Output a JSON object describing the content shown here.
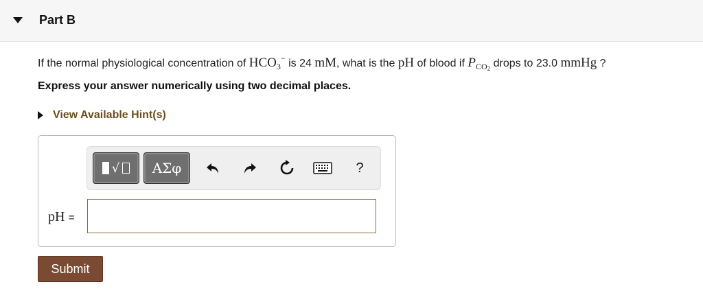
{
  "part": {
    "title": "Part B"
  },
  "question": {
    "t1": "If the normal physiological concentration of ",
    "ion": "HCO",
    "ion_sub": "3",
    "ion_sup": "−",
    "t2": " is 24 ",
    "conc_unit": "mM",
    "t3": ", what is the ",
    "ph": "pH",
    "t4": " of blood if ",
    "p": "P",
    "p_sub": "CO",
    "p_sub2": "2",
    "t5": " drops to 23.0 ",
    "pressure_unit": "mmHg",
    "t6": " ?"
  },
  "instruction": "Express your answer numerically using two decimal places.",
  "hint": {
    "label": "View Available Hint(s)"
  },
  "toolbar": {
    "symbols_label": "ΑΣφ",
    "help_label": "?",
    "icons": [
      "templates-icon",
      "symbols-icon",
      "undo-icon",
      "redo-icon",
      "reset-icon",
      "keyboard-icon",
      "help-icon"
    ]
  },
  "answer": {
    "label": "pH",
    "equals": "=",
    "value": ""
  },
  "submit": {
    "label": "Submit"
  },
  "colors": {
    "accent": "#7a4a33",
    "hint": "#6b4f1e",
    "input_border": "#8a6d2d"
  }
}
